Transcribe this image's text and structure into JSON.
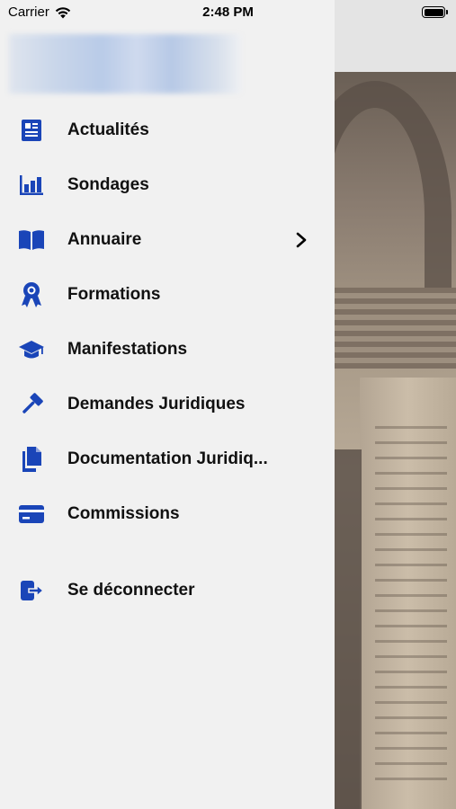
{
  "status_bar": {
    "carrier": "Carrier",
    "time": "2:48 PM",
    "battery_level": 1.0
  },
  "menu": {
    "items": [
      {
        "label": "Actualités",
        "icon": "newspaper-icon"
      },
      {
        "label": "Sondages",
        "icon": "bar-chart-icon"
      },
      {
        "label": "Annuaire",
        "icon": "book-icon",
        "has_submenu": true
      },
      {
        "label": "Formations",
        "icon": "award-ribbon-icon"
      },
      {
        "label": "Manifestations",
        "icon": "graduation-cap-icon"
      },
      {
        "label": "Demandes Juridiques",
        "icon": "gavel-icon"
      },
      {
        "label": "Documentation Juridiq...",
        "icon": "documents-icon"
      },
      {
        "label": "Commissions",
        "icon": "credit-card-icon"
      }
    ],
    "logout": {
      "label": "Se déconnecter",
      "icon": "sign-out-icon"
    }
  },
  "colors": {
    "accent": "#1a45b8",
    "drawer_bg": "#f1f1f1"
  }
}
